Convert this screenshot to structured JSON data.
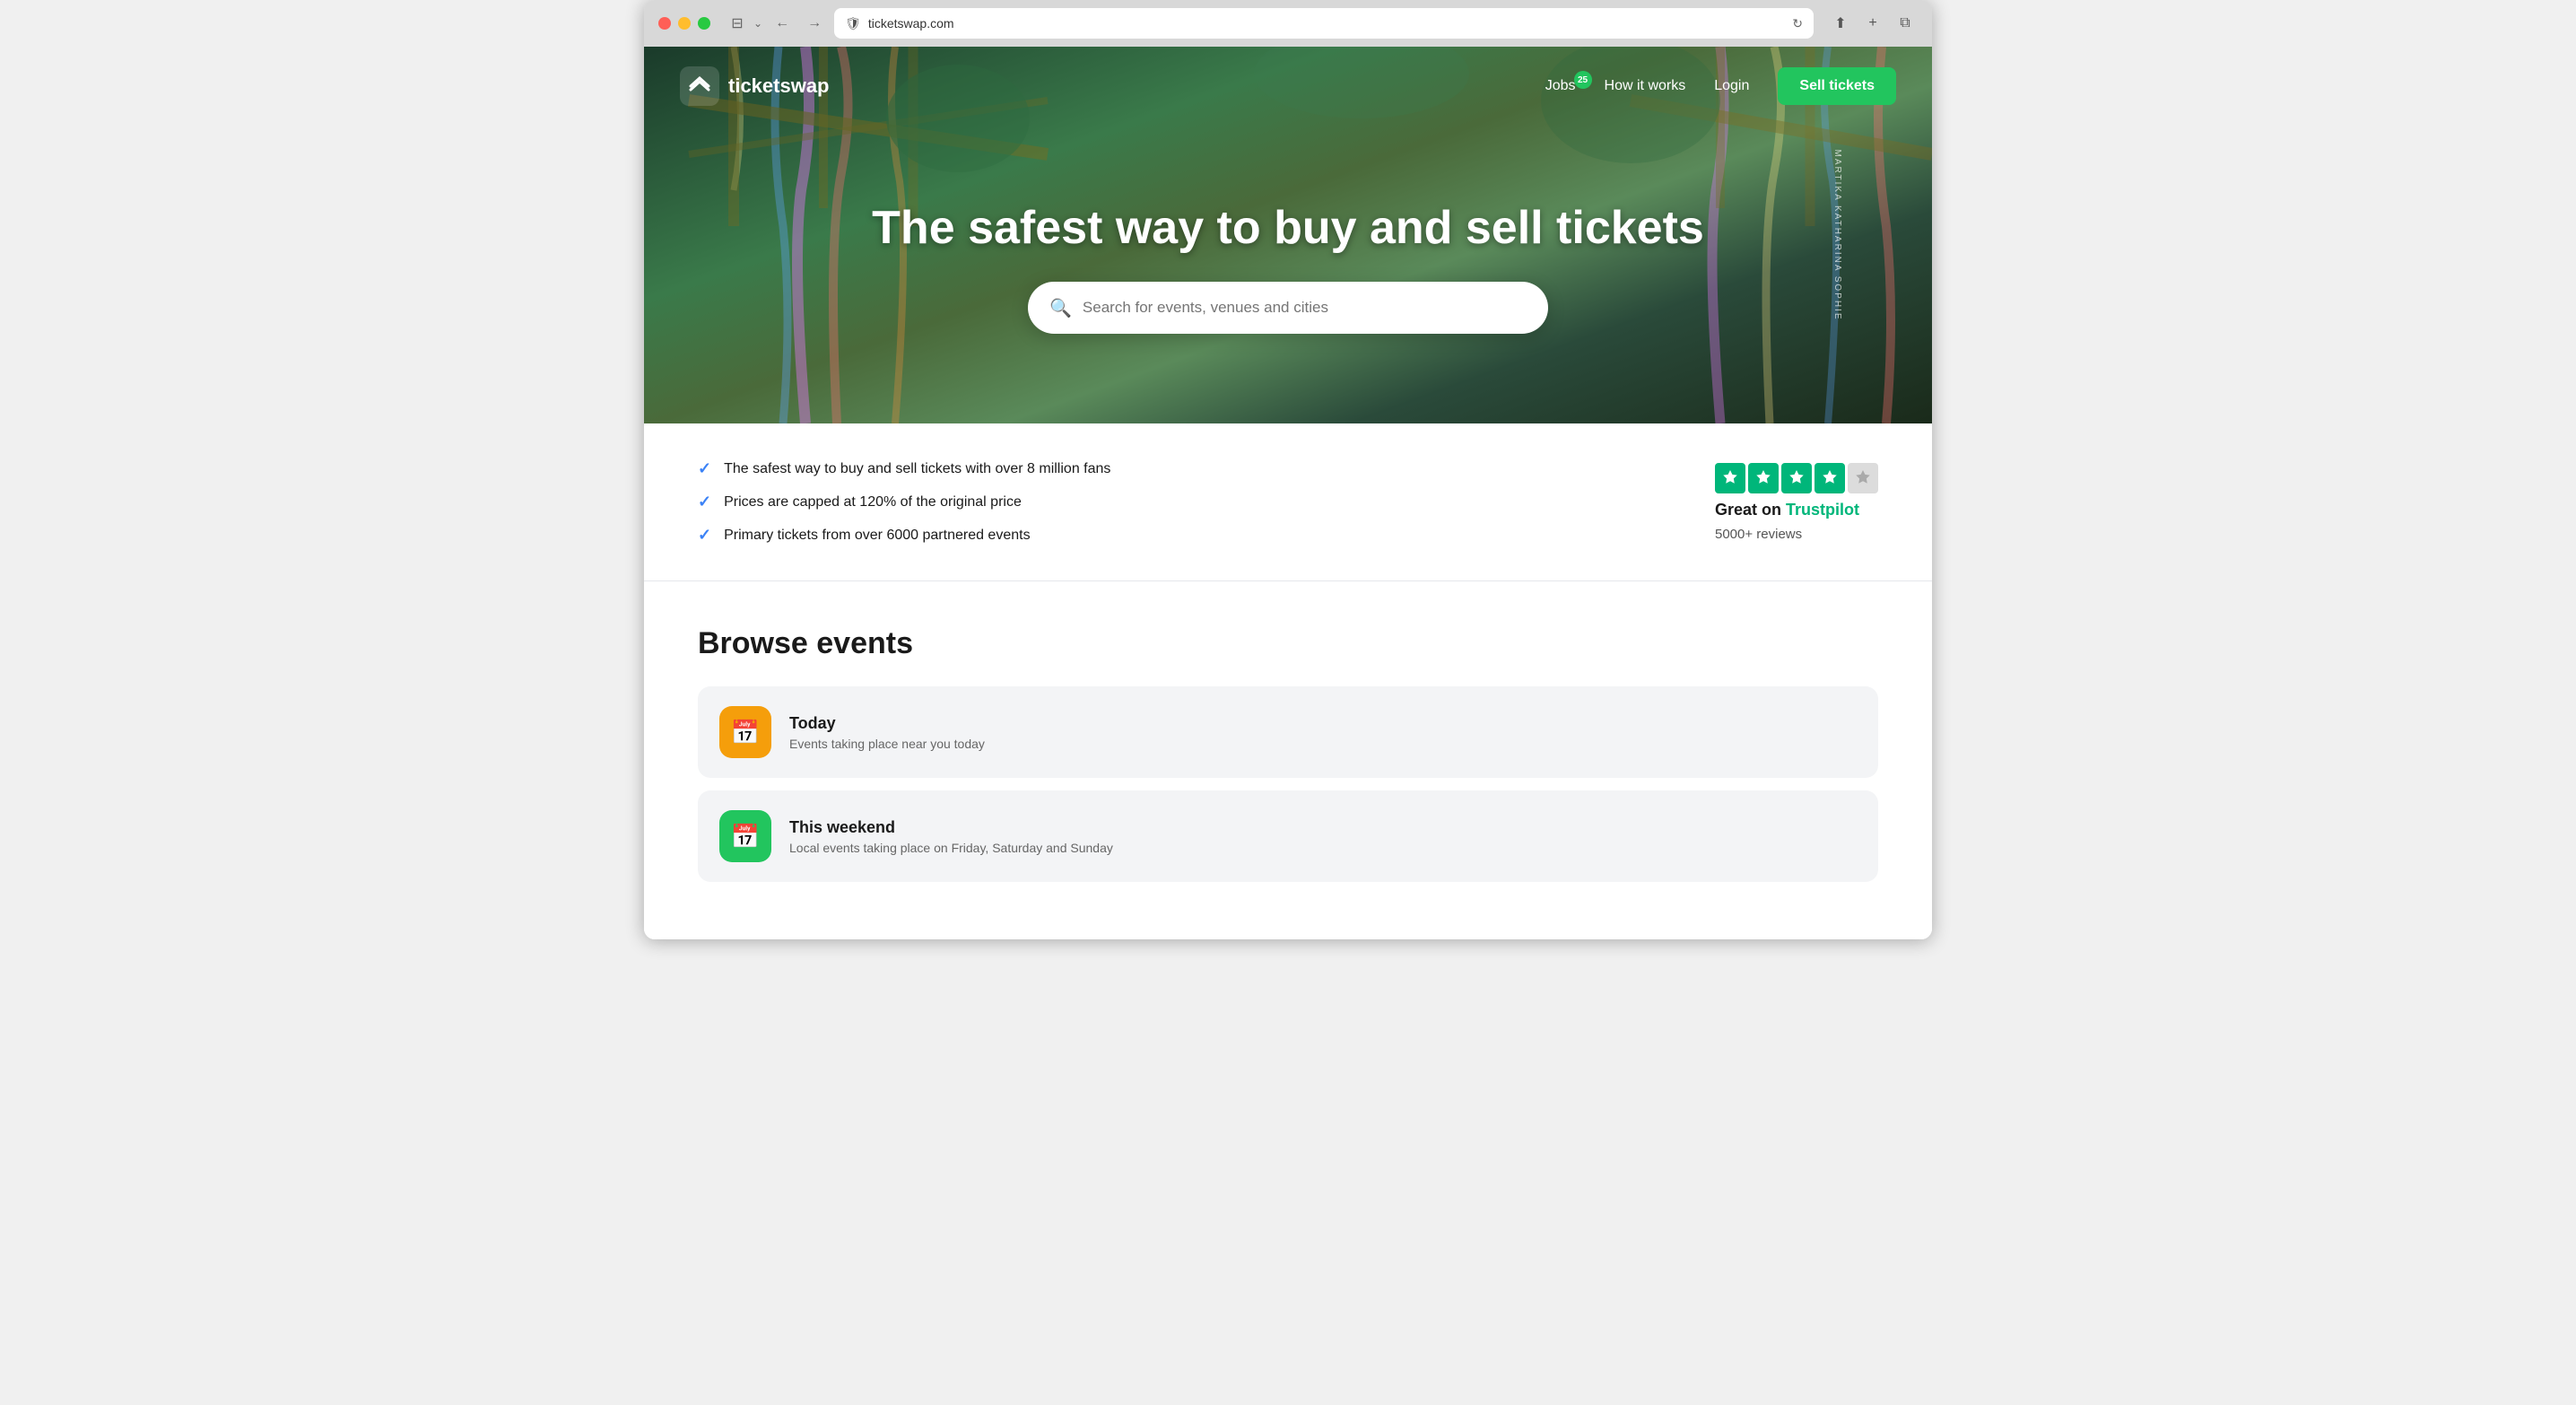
{
  "browser": {
    "url": "ticketswap.com",
    "back_label": "←",
    "forward_label": "→",
    "refresh_label": "↻",
    "share_label": "⬆",
    "new_tab_label": "+",
    "windows_label": "⧉"
  },
  "nav": {
    "logo_text": "ticketswap",
    "jobs_label": "Jobs",
    "jobs_badge": "25",
    "how_it_works_label": "How it works",
    "login_label": "Login",
    "sell_tickets_label": "Sell tickets"
  },
  "hero": {
    "headline": "The safest way to buy and sell tickets",
    "search_placeholder": "Search for events, venues and cities",
    "side_text": "MARTIKA KATHARINA SOPHIE"
  },
  "features": {
    "items": [
      "The safest way to buy and sell tickets with over 8 million fans",
      "Prices are capped at 120% of the original price",
      "Primary tickets from over 6000 partnered events"
    ],
    "trustpilot": {
      "rating_text": "Great on",
      "platform": "Trustpilot",
      "reviews": "5000+ reviews"
    }
  },
  "browse": {
    "title": "Browse events",
    "cards": [
      {
        "id": "today",
        "title": "Today",
        "subtitle": "Events taking place near you today",
        "icon": "📅",
        "icon_class": "icon-today"
      },
      {
        "id": "weekend",
        "title": "This weekend",
        "subtitle": "Local events taking place on Friday, Saturday and Sunday",
        "icon": "📅",
        "icon_class": "icon-weekend"
      }
    ]
  }
}
